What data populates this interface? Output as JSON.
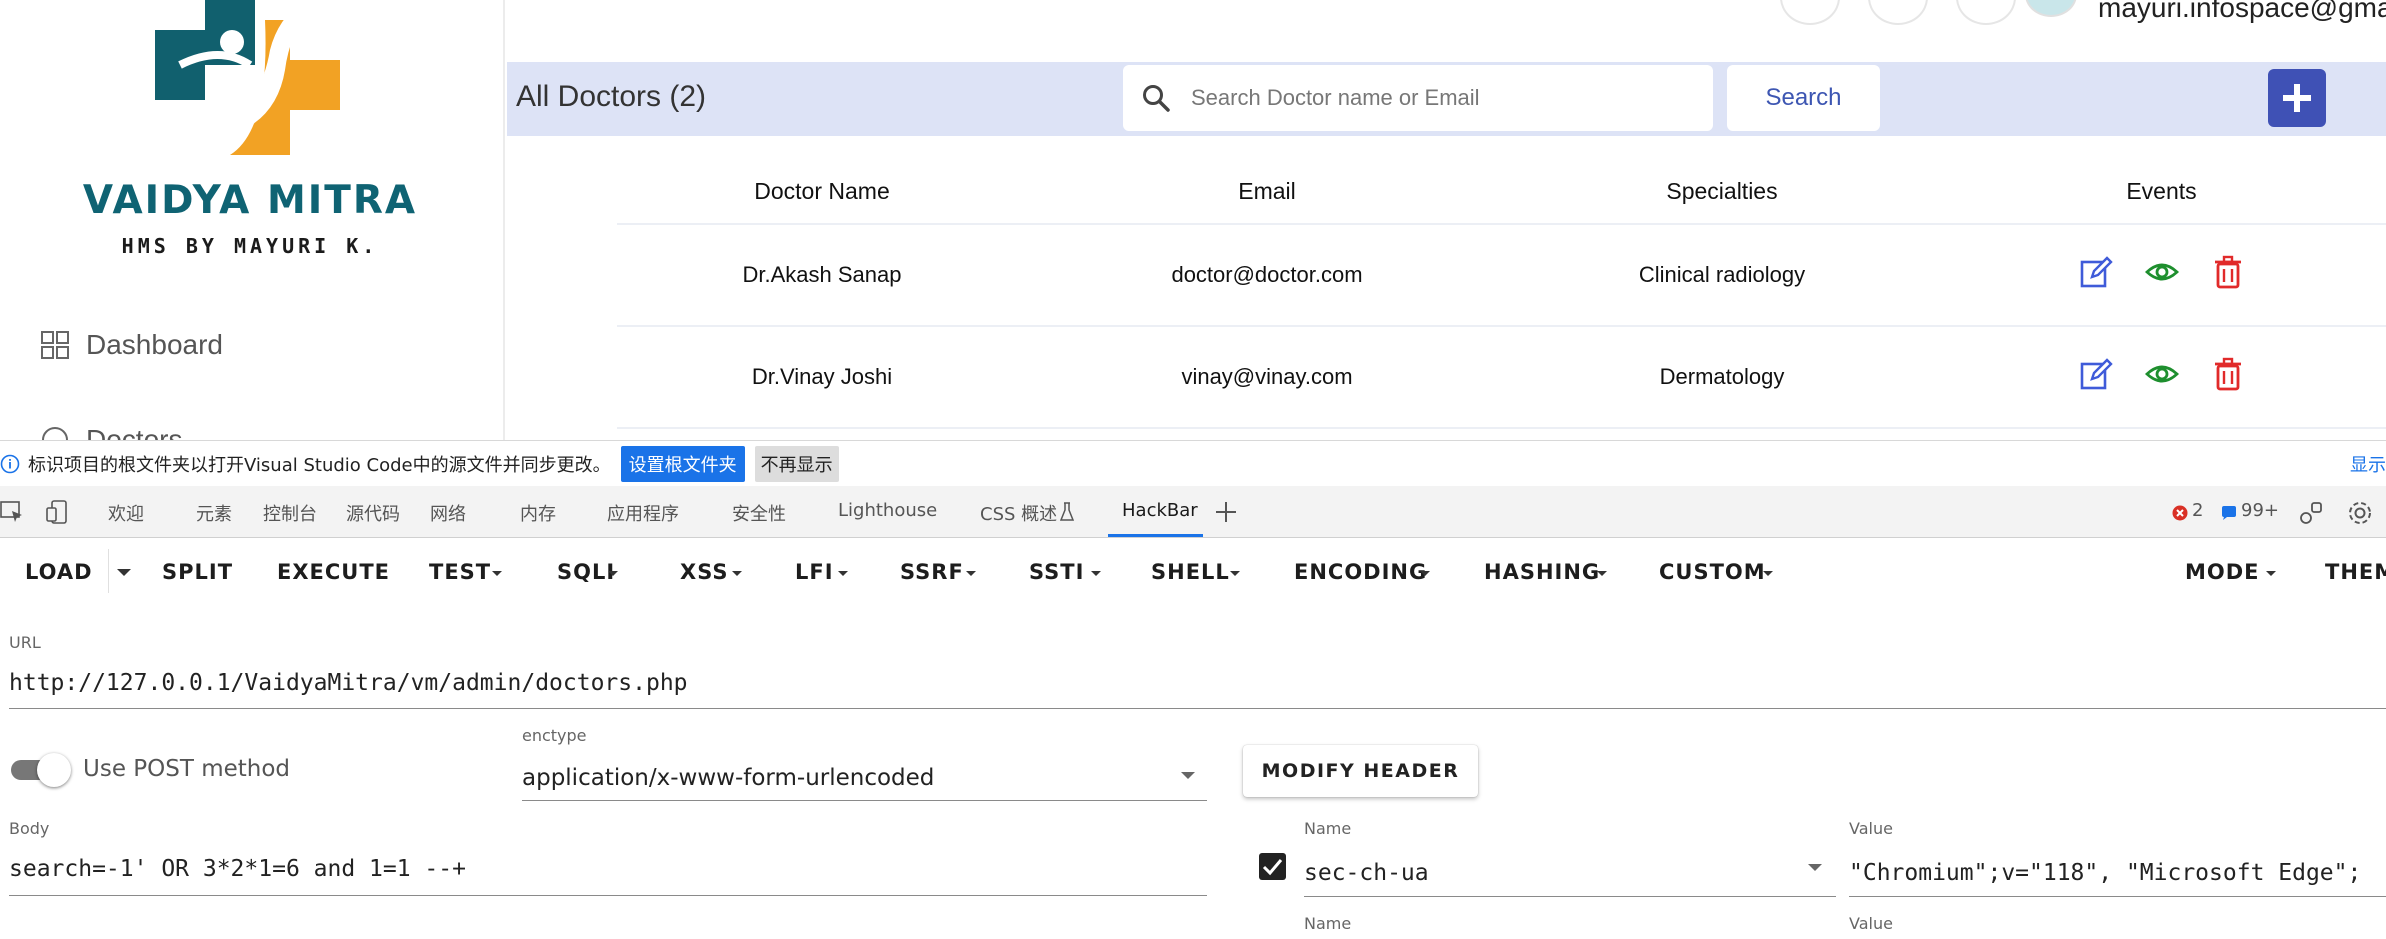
{
  "sidebar": {
    "brand": "VAIDYA MITRA",
    "tagline": "HMS  BY  MAYURI K.",
    "items": [
      {
        "label": "Dashboard",
        "icon": "dashboard-grid-icon"
      },
      {
        "label": "Doctors",
        "icon": "doctor-icon"
      }
    ]
  },
  "topbar": {
    "user_email": "mayuri.infospace@gmail.c"
  },
  "header": {
    "title": "All Doctors (2)",
    "search_placeholder": "Search Doctor name or Email",
    "search_button": "Search",
    "add_icon": "plus-icon",
    "accent": "#3f51b5"
  },
  "table": {
    "columns": [
      "Doctor Name",
      "Email",
      "Specialties",
      "Events"
    ],
    "rows": [
      {
        "name": "Dr.Akash Sanap",
        "email": "doctor@doctor.com",
        "specialty": "Clinical radiology"
      },
      {
        "name": "Dr.Vinay Joshi",
        "email": "vinay@vinay.com",
        "specialty": "Dermatology"
      }
    ],
    "event_icons": [
      "edit-icon",
      "view-eye-icon",
      "delete-trash-icon"
    ]
  },
  "devtools": {
    "info_text": "标识项目的根文件夹以打开Visual Studio Code中的源文件并同步更改。",
    "set_root_button": "设置根文件夹",
    "dont_show_button": "不再显示",
    "info_more": "显示",
    "tabs": [
      "欢迎",
      "元素",
      "控制台",
      "源代码",
      "网络",
      "内存",
      "应用程序",
      "安全性",
      "Lighthouse",
      "CSS 概述",
      "HackBar"
    ],
    "active_tab": "HackBar",
    "errors": "2",
    "messages": "99+"
  },
  "hackbar": {
    "toolbar": [
      "LOAD",
      "SPLIT",
      "EXECUTE",
      "TEST",
      "SQLI",
      "XSS",
      "LFI",
      "SSRF",
      "SSTI",
      "SHELL",
      "ENCODING",
      "HASHING",
      "CUSTOM",
      "MODE",
      "THEM"
    ],
    "url_label": "URL",
    "url": "http://127.0.0.1/VaidyaMitra/vm/admin/doctors.php",
    "post_label": "Use POST method",
    "post_enabled": false,
    "enctype_label": "enctype",
    "enctype": "application/x-www-form-urlencoded",
    "modify_header": "MODIFY HEADER",
    "body_label": "Body",
    "body": "search=-1' OR 3*2*1=6 and 1=1 --+",
    "header_name_label": "Name",
    "header_name": "sec-ch-ua",
    "header_value_label": "Value",
    "header_value": "\"Chromium\";v=\"118\", \"Microsoft Edge\";",
    "header_name_label_2": "Name",
    "header_value_label_2": "Value"
  }
}
